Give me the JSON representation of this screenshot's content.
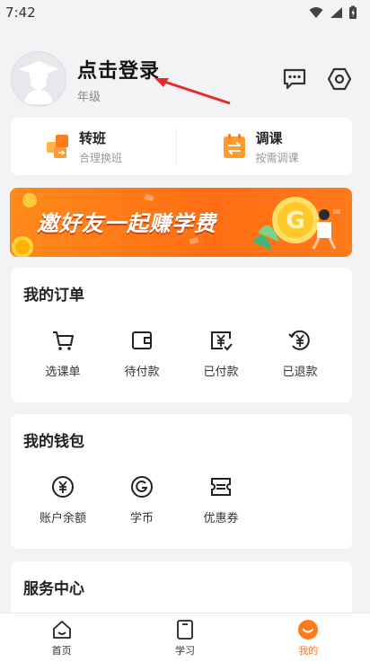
{
  "status_bar": {
    "time": "7:42",
    "icons": [
      "wifi-icon",
      "signal-icon",
      "battery-icon"
    ]
  },
  "profile": {
    "login_text": "点击登录",
    "grade_text": "年级",
    "actions": [
      "message-icon",
      "settings-hex-icon"
    ]
  },
  "class_actions": [
    {
      "title": "转班",
      "subtitle": "合理换班",
      "icon": "transfer-class-icon"
    },
    {
      "title": "调课",
      "subtitle": "按需调课",
      "icon": "adjust-course-icon"
    }
  ],
  "banner": {
    "text": "邀好友一起赚学费"
  },
  "orders": {
    "title": "我的订单",
    "items": [
      {
        "label": "选课单",
        "icon": "cart-icon"
      },
      {
        "label": "待付款",
        "icon": "wallet-icon"
      },
      {
        "label": "已付款",
        "icon": "paid-icon"
      },
      {
        "label": "已退款",
        "icon": "refund-icon"
      }
    ]
  },
  "wallet": {
    "title": "我的钱包",
    "items": [
      {
        "label": "账户余额",
        "icon": "yen-circle-icon"
      },
      {
        "label": "学币",
        "icon": "coin-g-icon"
      },
      {
        "label": "优惠券",
        "icon": "coupon-icon"
      }
    ]
  },
  "service": {
    "title": "服务中心"
  },
  "tabbar": {
    "tabs": [
      {
        "label": "首页",
        "icon": "home-icon",
        "active": false
      },
      {
        "label": "学习",
        "icon": "study-icon",
        "active": false
      },
      {
        "label": "我的",
        "icon": "mine-icon",
        "active": true
      }
    ]
  },
  "colors": {
    "accent": "#ff7a1a",
    "background": "#f3f3f5",
    "banner": "#ff6e13"
  }
}
